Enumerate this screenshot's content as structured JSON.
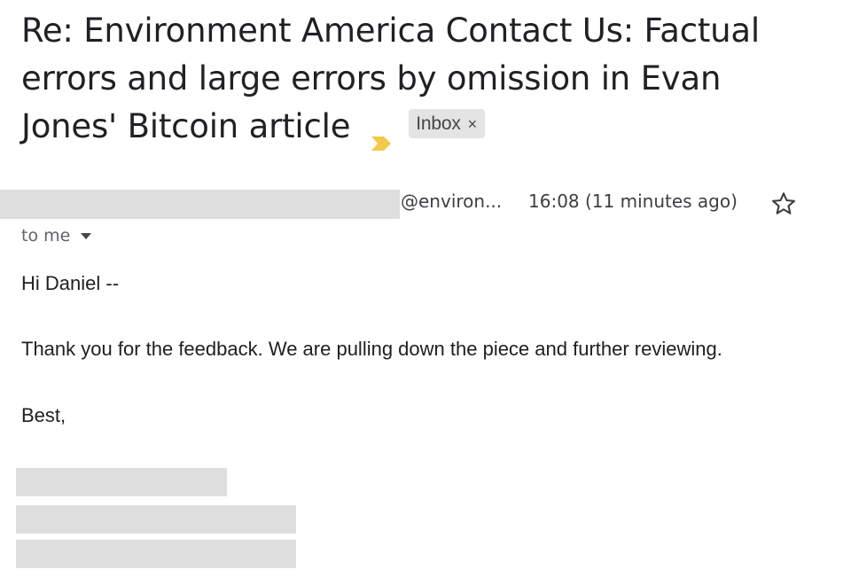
{
  "email": {
    "subject": "Re: Environment America Contact Us: Factual errors and large errors by omission in Evan Jones' Bitcoin article",
    "importance_icon": "importance-marker-icon",
    "label": {
      "name": "Inbox",
      "remove_glyph": "×"
    },
    "sender": {
      "domain": "@environ..."
    },
    "timestamp": "16:08 (11 minutes ago)",
    "star_icon": "star-icon",
    "recipient": "to me",
    "body": {
      "greeting": "Hi Daniel --",
      "message": "Thank you for the feedback. We are pulling down the piece and further reviewing.",
      "signoff": "Best,"
    }
  },
  "colors": {
    "importance": "#f2c94c",
    "chip_background": "#e4e4e4",
    "redaction": "#dedede"
  }
}
